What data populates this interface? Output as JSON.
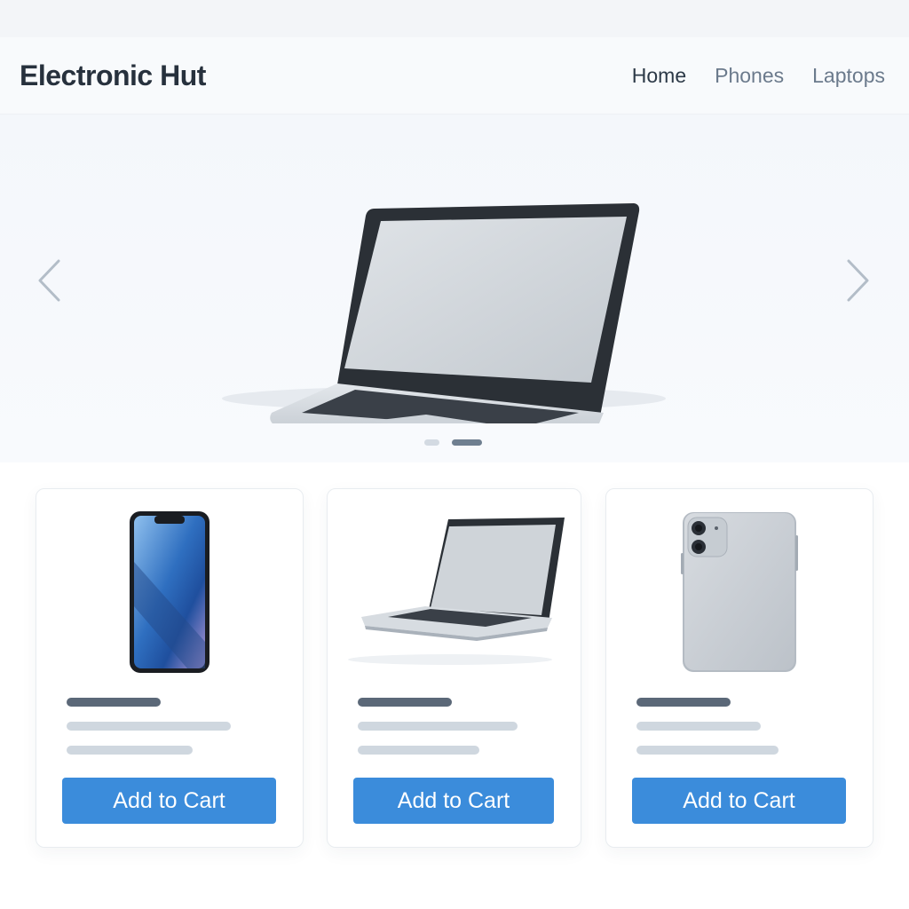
{
  "header": {
    "brand": "Electronic Hut",
    "nav": [
      {
        "label": "Home",
        "active": true
      },
      {
        "label": "Phones",
        "active": false
      },
      {
        "label": "Laptops",
        "active": false
      }
    ]
  },
  "hero": {
    "slide_count": 2,
    "active_slide": 2,
    "image": "laptop"
  },
  "products": [
    {
      "image": "phone-front",
      "button_label": "Add to Cart"
    },
    {
      "image": "laptop",
      "button_label": "Add to Cart"
    },
    {
      "image": "phone-back",
      "button_label": "Add to Cart"
    }
  ],
  "colors": {
    "accent": "#3b8cdb",
    "brand_text": "#27313d",
    "nav_text": "#6b7a8c"
  }
}
